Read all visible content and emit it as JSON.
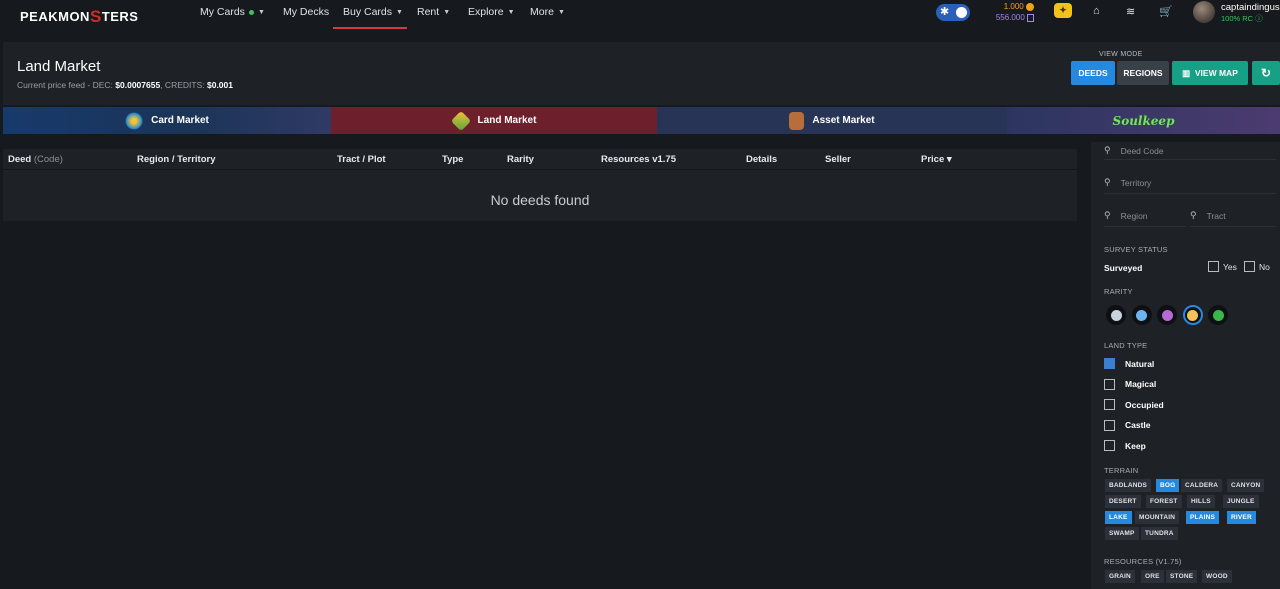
{
  "nav": {
    "logo_a": "PEAKMON",
    "logo_b": "S",
    "logo_c": "TERS",
    "items": [
      "My Cards",
      "My Decks",
      "Buy Cards",
      "Rent",
      "Explore",
      "More"
    ],
    "balance_dec": "1.000",
    "balance_credits": "556.000",
    "username": "captaindingus",
    "rc": "100% RC"
  },
  "header": {
    "title": "Land Market",
    "price_feed_label": "Current price feed - DEC:",
    "dec_price": "$0.0007655",
    "credits_label": ", CREDITS:",
    "credits_price": "$0.001",
    "view_mode_label": "VIEW MODE",
    "deeds": "DEEDS",
    "regions": "REGIONS",
    "view_map": "VIEW MAP"
  },
  "markets": {
    "card": "Card Market",
    "land": "Land Market",
    "asset": "Asset Market",
    "solo": "Soulkeep"
  },
  "table": {
    "columns": {
      "deed": "Deed",
      "deed_code": "(Code)",
      "region": "Region / Territory",
      "tract": "Tract / Plot",
      "type": "Type",
      "rarity": "Rarity",
      "resources": "Resources v1.75",
      "details": "Details",
      "seller": "Seller",
      "price": "Price"
    },
    "empty": "No deeds found"
  },
  "filters": {
    "deed_code": "Deed Code",
    "territory": "Territory",
    "region": "Region",
    "tract": "Tract",
    "survey_status": "SURVEY STATUS",
    "surveyed": "Surveyed",
    "yes": "Yes",
    "no": "No",
    "rarity": "RARITY",
    "rarity_colors": [
      "#c9d3dc",
      "#6fb3ee",
      "#b76ad6",
      "#f2c15a",
      "#3cb54a"
    ],
    "rarity_selected": 3,
    "land_type": "LAND TYPE",
    "land_types": [
      {
        "label": "Natural",
        "checked": true
      },
      {
        "label": "Magical",
        "checked": false
      },
      {
        "label": "Occupied",
        "checked": false
      },
      {
        "label": "Castle",
        "checked": false
      },
      {
        "label": "Keep",
        "checked": false
      }
    ],
    "terrain": "TERRAIN",
    "terrains": [
      {
        "label": "BADLANDS",
        "on": false
      },
      {
        "label": "BOG",
        "on": true
      },
      {
        "label": "CALDERA",
        "on": false
      },
      {
        "label": "CANYON",
        "on": false
      },
      {
        "label": "DESERT",
        "on": false
      },
      {
        "label": "FOREST",
        "on": false
      },
      {
        "label": "HILLS",
        "on": false
      },
      {
        "label": "JUNGLE",
        "on": false
      },
      {
        "label": "LAKE",
        "on": true
      },
      {
        "label": "MOUNTAIN",
        "on": false
      },
      {
        "label": "PLAINS",
        "on": true
      },
      {
        "label": "RIVER",
        "on": true
      },
      {
        "label": "SWAMP",
        "on": false
      },
      {
        "label": "TUNDRA",
        "on": false
      }
    ],
    "resources": "RESOURCES (V1.75)",
    "resource_tags": [
      "GRAIN",
      "ORE",
      "STONE",
      "WOOD"
    ]
  }
}
